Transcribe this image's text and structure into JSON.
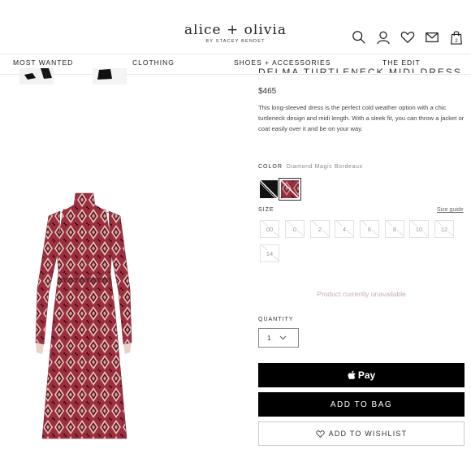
{
  "header": {
    "brand_name": "alice + olivia",
    "brand_sub": "BY STACEY BENDET",
    "cart_count": "2",
    "icons": [
      "search-icon",
      "account-icon",
      "wishlist-heart-icon",
      "mail-icon",
      "shopping-bag-icon"
    ]
  },
  "nav": {
    "items": [
      {
        "label": "MOST WANTED"
      },
      {
        "label": "CLOTHING"
      },
      {
        "label": "SHOES + ACCESSORIES"
      },
      {
        "label": "THE EDIT"
      }
    ]
  },
  "product": {
    "title": "DELMA TURTLENECK MIDI DRESS",
    "price": "$465",
    "description": "This long-sleeved dress is the perfect cold weather option with a chic turtleneck design and midi length. With a sleek fit, you can throw a jacket or coat easily over it and be on your way.",
    "color_label": "COLOR",
    "color_value": "Diamond Magic Bordeaux",
    "size_label": "SIZE",
    "size_guide": "Size guide",
    "sizes": [
      "00",
      "0",
      "2",
      "4",
      "6",
      "8",
      "10",
      "12",
      "14"
    ],
    "unavailable": "Product currently unavailable",
    "quantity_label": "QUANTITY",
    "quantity_value": "1",
    "pay_label": "Pay",
    "add_to_bag": "ADD TO BAG",
    "add_to_wishlist": "ADD TO WISHLIST"
  },
  "colors": {
    "swatch_black": "#111111",
    "swatch_bordeaux": "#8b2a3a",
    "unavailable_text": "#c9a9ba"
  }
}
